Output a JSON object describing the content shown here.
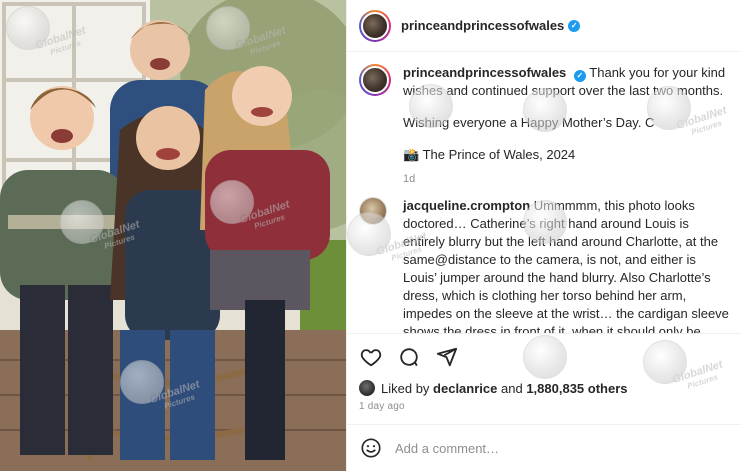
{
  "post": {
    "header": {
      "username": "princeandprincessofwales",
      "verified": true
    },
    "caption": {
      "username": "princeandprincessofwales",
      "line1": "Thank you for your kind wishes and continued support over the last two months.",
      "line2": "Wishing everyone a Happy Mother’s Day. C",
      "line3": "📸 The Prince of Wales, 2024",
      "time": "1d"
    },
    "comment": {
      "username": "jacqueline.crompton",
      "text": "Ummmmm, this photo looks doctored… Catherine’s right hand around Louis is entirely blurry but the left hand around Charlotte, at the same@distance to the camera, is not, and either is Louis’ jumper around the hand blurry. Also Charlotte’s dress, which is clothing her torso behind her arm, impedes on the sleeve at the wrist… the cardigan sleeve shows the dress in front of it, when it should only be behind. And Louis’ middle finger must be awfully long to be entirely wrapped around the next"
    },
    "likes": {
      "prefix": "Liked by",
      "user": "declanrice",
      "suffix": "and",
      "count_text": "1,880,835 others"
    },
    "date": "1 day ago",
    "comment_placeholder": "Add a comment…",
    "icons": {
      "like": "heart-icon",
      "comment": "comment-icon",
      "share": "paper-plane-icon",
      "emoji": "smiley-icon",
      "verified": "verified-badge-icon"
    }
  },
  "watermark": {
    "brand": "GlobalNet",
    "sub": "Pictures"
  },
  "colors": {
    "verified": "#1d9bf0",
    "muted": "#8e8e8e",
    "text": "#262626",
    "border": "#efefef"
  }
}
